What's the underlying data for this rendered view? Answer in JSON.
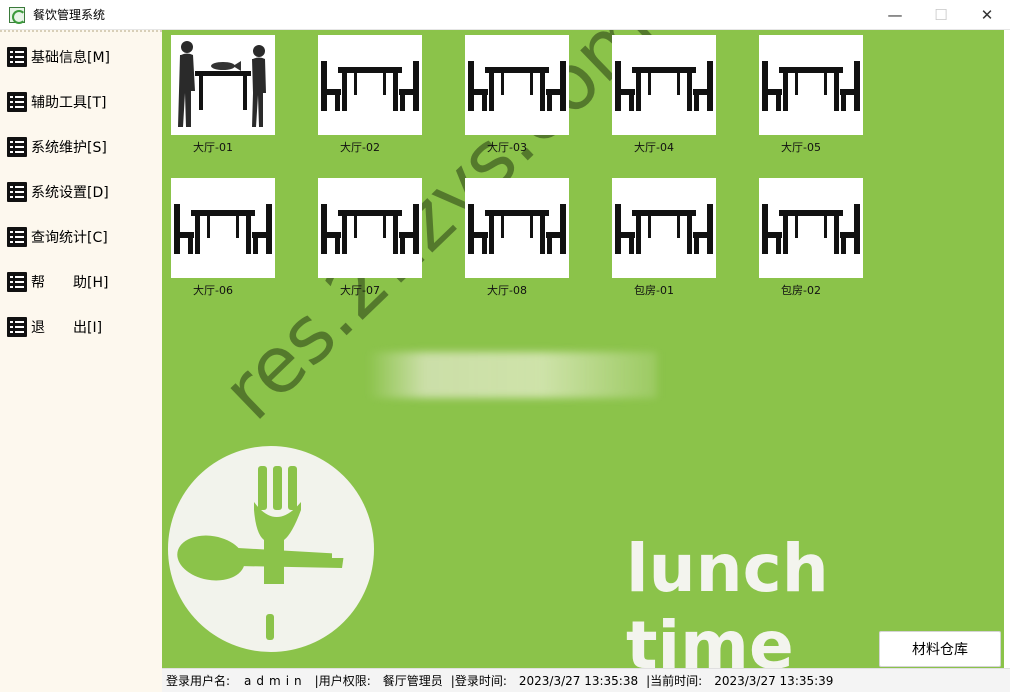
{
  "window": {
    "title": "餐饮管理系统",
    "minimize_icon": "minimize-icon",
    "maximize_icon": "maximize-icon",
    "close_icon": "close-icon",
    "minimize_glyph": "—",
    "maximize_glyph": "☐",
    "close_glyph": "✕"
  },
  "menu": {
    "items": [
      {
        "label": "基础信息[M]",
        "icon": "list-icon"
      },
      {
        "label": "辅助工具[T]",
        "icon": "list-icon"
      },
      {
        "label": "系统维护[S]",
        "icon": "list-icon"
      },
      {
        "label": "系统设置[D]",
        "icon": "list-icon"
      },
      {
        "label": "查询统计[C]",
        "icon": "list-icon"
      },
      {
        "label": "帮　　助[H]",
        "icon": "list-icon"
      },
      {
        "label": "退　　出[I]",
        "icon": "list-icon"
      }
    ]
  },
  "tables": [
    {
      "label": "大厅-01",
      "status": "occupied"
    },
    {
      "label": "大厅-02",
      "status": "free"
    },
    {
      "label": "大厅-03",
      "status": "free"
    },
    {
      "label": "大厅-04",
      "status": "free"
    },
    {
      "label": "大厅-05",
      "status": "free"
    },
    {
      "label": "大厅-06",
      "status": "free"
    },
    {
      "label": "大厅-07",
      "status": "free"
    },
    {
      "label": "大厅-08",
      "status": "free"
    },
    {
      "label": "包房-01",
      "status": "free"
    },
    {
      "label": "包房-02",
      "status": "free"
    }
  ],
  "background": {
    "slogan": "lunch time",
    "watermark": "res.21zys.com",
    "color": "#8bc34a"
  },
  "actions": {
    "material_label": "材料仓库"
  },
  "status": {
    "user_label": "登录用户名:",
    "user_value": "admin",
    "role_label": "用户权限:",
    "role_value": "餐厅管理员",
    "login_label": "登录时间:",
    "login_value": "2023/3/27 13:35:38",
    "now_label": "当前时间:",
    "now_value": "2023/3/27 13:35:39",
    "separator": "|"
  }
}
